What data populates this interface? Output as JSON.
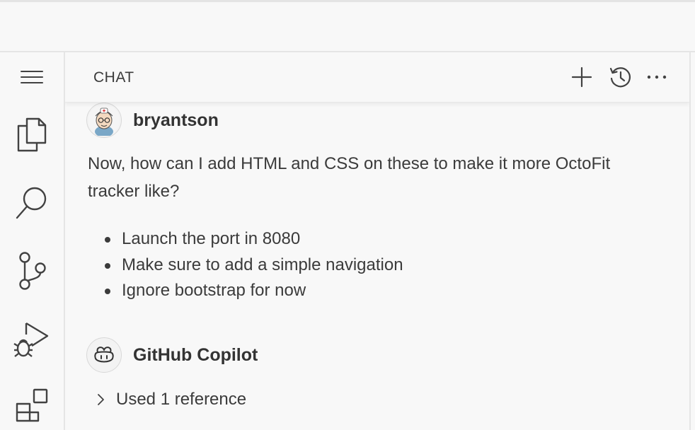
{
  "activity_bar": {
    "items": [
      {
        "name": "menu-icon"
      },
      {
        "name": "explorer-icon"
      },
      {
        "name": "search-icon"
      },
      {
        "name": "source-control-icon"
      },
      {
        "name": "run-debug-icon"
      },
      {
        "name": "extensions-icon"
      }
    ]
  },
  "chat": {
    "title": "CHAT",
    "actions": [
      "new-chat-icon",
      "history-icon",
      "more-icon"
    ],
    "messages": [
      {
        "author": "bryantson",
        "avatar": "user-avatar",
        "text": "Now, how can I add HTML and CSS on these to make it more OctoFit tracker like?",
        "bullets": [
          "Launch the port in 8080",
          "Make sure to add a simple navigation",
          "Ignore bootstrap for now"
        ]
      },
      {
        "author": "GitHub Copilot",
        "avatar": "copilot-icon",
        "reference_label": "Used 1 reference"
      }
    ]
  },
  "colors": {
    "background": "#f8f8f8",
    "border": "#e5e5e5",
    "text": "#3b3b3b",
    "icon": "#424242"
  }
}
